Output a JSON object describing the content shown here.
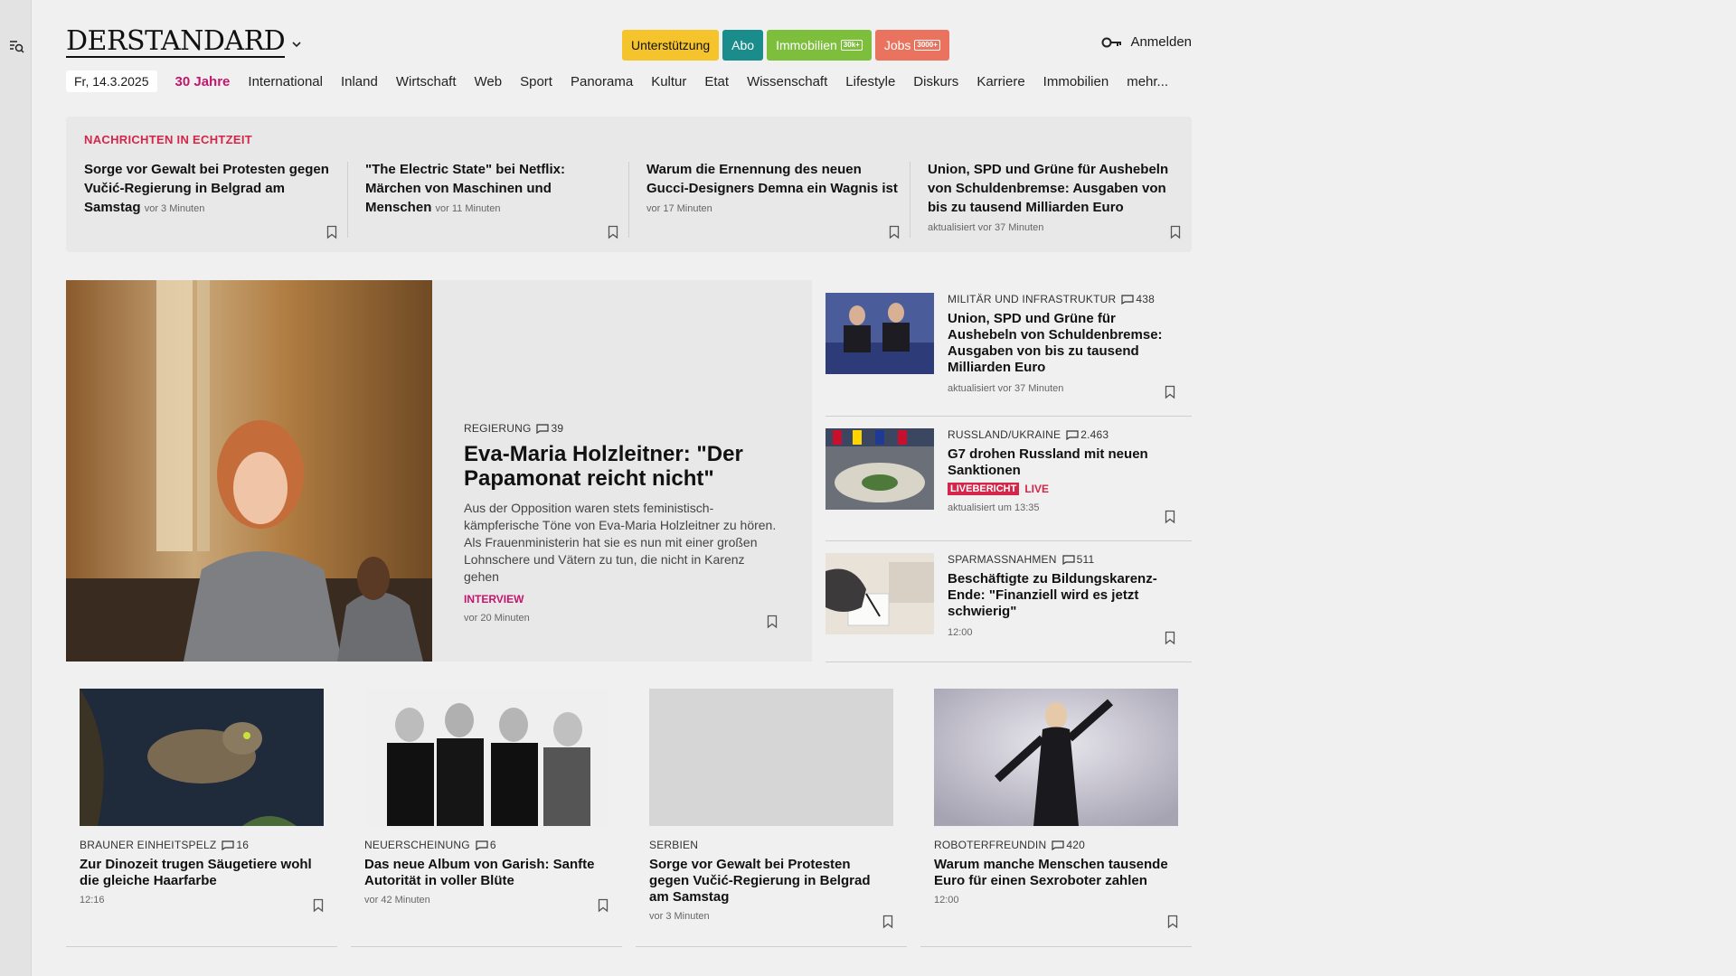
{
  "header": {
    "logo": "DERSTANDARD",
    "pills": [
      {
        "label": "Unterstützung",
        "tag": ""
      },
      {
        "label": "Abo",
        "tag": ""
      },
      {
        "label": "Immobilien",
        "tag": "30k+"
      },
      {
        "label": "Jobs",
        "tag": "3000+"
      }
    ],
    "login": "Anmelden"
  },
  "nav": {
    "date": "Fr, 14.3.2025",
    "items": [
      "30 Jahre",
      "International",
      "Inland",
      "Wirtschaft",
      "Web",
      "Sport",
      "Panorama",
      "Kultur",
      "Etat",
      "Wissenschaft",
      "Lifestyle",
      "Diskurs",
      "Karriere",
      "Immobilien",
      "mehr..."
    ]
  },
  "ticker": {
    "title": "NACHRICHTEN IN ECHTZEIT",
    "items": [
      {
        "title": "Sorge vor Gewalt bei Protesten gegen Vučić-Regierung in Belgrad am Samstag",
        "meta": "vor 3 Minuten"
      },
      {
        "title": "\"The Electric State\" bei Netflix: Märchen von Maschinen und Menschen",
        "meta": "vor 11 Minuten"
      },
      {
        "title": "Warum die Ernennung des neuen Gucci-Designers Demna ein Wagnis ist",
        "meta": "vor 17 Minuten"
      },
      {
        "title": "Union, SPD und Grüne für Aushebeln von Schuldenbremse: Ausgaben von bis zu tausend Milliarden Euro",
        "meta": "aktualisiert vor 37 Minuten"
      }
    ]
  },
  "lead": {
    "kicker": "REGIERUNG",
    "comments": "39",
    "title": "Eva-Maria Holzleitner: \"Der Papamonat reicht nicht\"",
    "teaser": "Aus der Opposition waren stets feministisch-kämpferische Töne von Eva-Maria Holzleitner zu hören. Als Frauenministerin hat sie es nun mit einer großen Lohnschere und Vätern zu tun, die nicht in Karenz gehen",
    "label": "INTERVIEW",
    "meta": "vor 20 Minuten"
  },
  "side": [
    {
      "kicker": "MILITÄR UND INFRASTRUKTUR",
      "comments": "438",
      "title": "Union, SPD und Grüne für Aushebeln von Schuldenbremse: Ausgaben von bis zu tausend Milliarden Euro",
      "meta": "aktualisiert vor 37 Minuten"
    },
    {
      "kicker": "RUSSLAND/UKRAINE",
      "comments": "2.463",
      "title": "G7 drohen Russland mit neuen Sanktionen",
      "live_badge": "LIVEBERICHT",
      "live_text": "LIVE",
      "meta": "aktualisiert um 13:35"
    },
    {
      "kicker": "SPARMASSNAHMEN",
      "comments": "511",
      "title": "Beschäftigte zu Bildungskarenz-Ende: \"Finanziell wird es jetzt schwierig\"",
      "meta": "12:00"
    }
  ],
  "cards": [
    {
      "kicker": "BRAUNER EINHEITSPELZ",
      "comments": "16",
      "title": "Zur Dinozeit trugen Säugetiere wohl die gleiche Haarfarbe",
      "meta": "12:16"
    },
    {
      "kicker": "NEUERSCHEINUNG",
      "comments": "6",
      "title": "Das neue Album von Garish: Sanfte Autorität in voller Blüte",
      "meta": "vor 42 Minuten"
    },
    {
      "kicker": "SERBIEN",
      "comments": "",
      "title": "Sorge vor Gewalt bei Protesten gegen Vučić-Regierung in Belgrad am Samstag",
      "meta": "vor 3 Minuten"
    },
    {
      "kicker": "ROBOTERFREUNDIN",
      "comments": "420",
      "title": "Warum manche Menschen tausende Euro für einen Sexroboter zahlen",
      "meta": "12:00"
    }
  ],
  "colors": {
    "accent": "#c4156e",
    "live": "#d3264a",
    "abo": "#1a8c8c",
    "support": "#f5c42c",
    "immo": "#7dbf3c",
    "jobs": "#e9735e"
  }
}
